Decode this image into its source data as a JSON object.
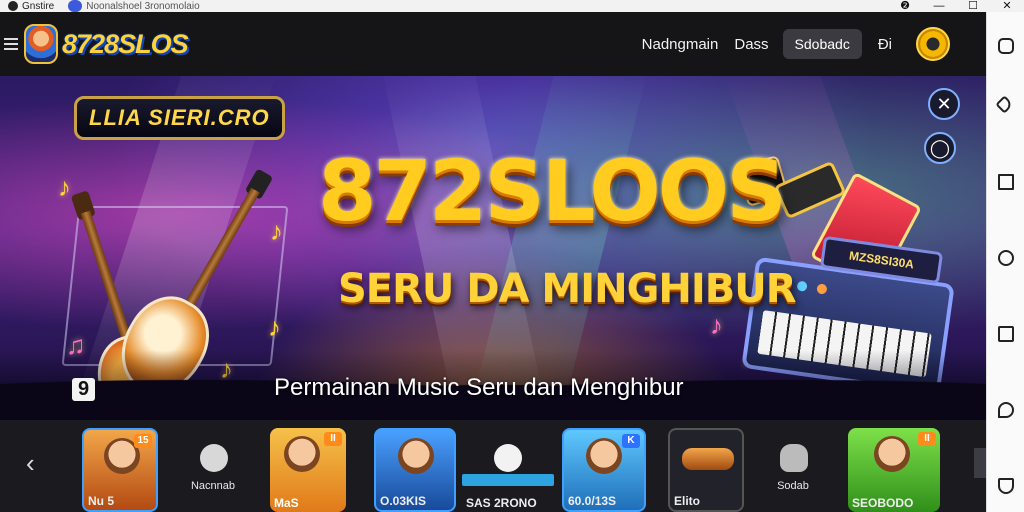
{
  "os": {
    "tab1": "Gnstire",
    "tab2": "Noonalshoel 3ronomolaio",
    "controls": [
      "❷",
      "—",
      "☐",
      "✕"
    ]
  },
  "header": {
    "brand": "8728SLOS",
    "nav": [
      "Nadngmain",
      "Dass"
    ],
    "button": "Sdobadc",
    "extra": "Đi"
  },
  "hero": {
    "badge": "LLIA SIERI.CRO",
    "title": "872SLOOS",
    "subtitle": "SERU DA MINGHIBUR",
    "caption": "Permainan Music Seru dan Menghibur",
    "corner": "9",
    "keyboard_screen": "MZS8SI30A",
    "close_icon_glyph": "✕"
  },
  "carousel": {
    "arrow_left": "‹",
    "tiles": [
      {
        "tag": "15",
        "label": "Nu 5"
      },
      {
        "label": "Nacnnab"
      },
      {
        "tag": "II",
        "label": "MaS"
      },
      {
        "label": "O.03KIS"
      },
      {
        "label": "SAS 2RONO"
      },
      {
        "tag": "K",
        "label": "60.0/13S"
      },
      {
        "label": "Elito"
      },
      {
        "label": "Sodab"
      },
      {
        "tag": "II",
        "label": "SEOBODO"
      }
    ],
    "mini_labels": [
      "Nacnnab",
      "Sodab"
    ]
  }
}
